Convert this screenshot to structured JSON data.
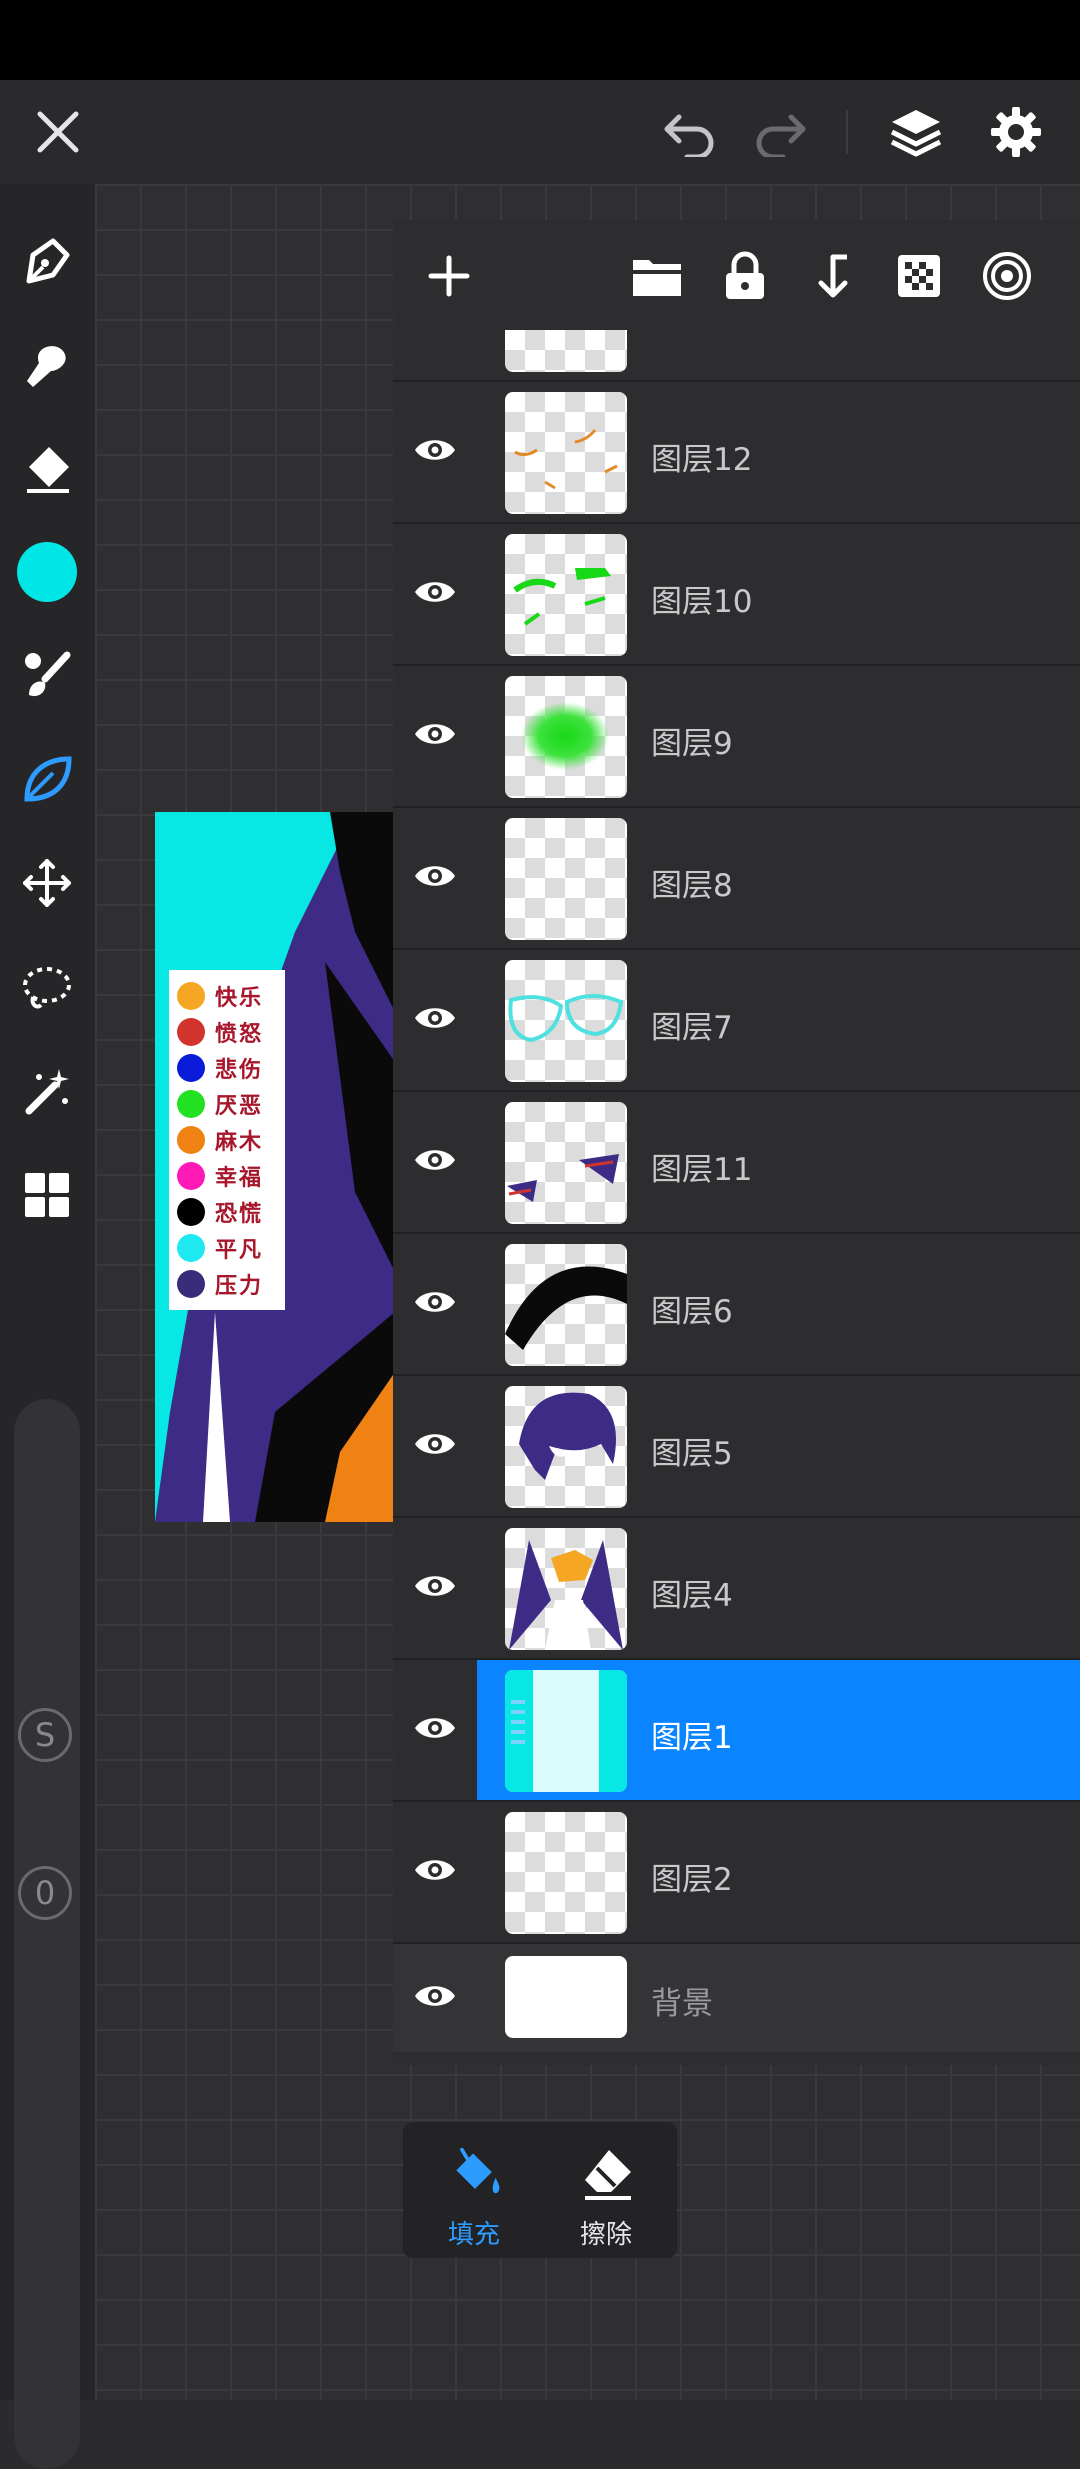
{
  "topbar": {
    "icons": [
      "close-icon",
      "undo-icon",
      "redo-icon",
      "layers-icon",
      "settings-icon"
    ]
  },
  "sidebar": {
    "icons": [
      "pen-icon",
      "smudge-icon",
      "eraser-icon",
      "color-swatch",
      "brush-icon",
      "leaf-icon",
      "move-icon",
      "lasso-icon",
      "magic-wand-icon",
      "grid-icon"
    ],
    "current_color": "#00e5e5",
    "size_label": "S",
    "opacity_label": "0"
  },
  "artwork_legend": [
    {
      "color": "#f5a623",
      "text": "快乐"
    },
    {
      "color": "#d0342c",
      "text": "愤怒"
    },
    {
      "color": "#0a1bd9",
      "text": "悲伤"
    },
    {
      "color": "#22e022",
      "text": "厌恶"
    },
    {
      "color": "#f08214",
      "text": "麻木"
    },
    {
      "color": "#ff1ab8",
      "text": "幸福"
    },
    {
      "color": "#000000",
      "text": "恐慌"
    },
    {
      "color": "#1ee8f0",
      "text": "平凡"
    },
    {
      "color": "#3a2c7a",
      "text": "压力"
    }
  ],
  "layers_panel": {
    "toolbar_icons": [
      "add-icon",
      "folder-icon",
      "lock-icon",
      "merge-down-icon",
      "transparency-icon",
      "reference-icon"
    ],
    "layers": [
      {
        "name": "图层12",
        "visible": true,
        "selected": false
      },
      {
        "name": "图层10",
        "visible": true,
        "selected": false
      },
      {
        "name": "图层9",
        "visible": true,
        "selected": false
      },
      {
        "name": "图层8",
        "visible": true,
        "selected": false
      },
      {
        "name": "图层7",
        "visible": true,
        "selected": false
      },
      {
        "name": "图层11",
        "visible": true,
        "selected": false
      },
      {
        "name": "图层6",
        "visible": true,
        "selected": false
      },
      {
        "name": "图层5",
        "visible": true,
        "selected": false
      },
      {
        "name": "图层4",
        "visible": true,
        "selected": false
      },
      {
        "name": "图层1",
        "visible": true,
        "selected": true
      },
      {
        "name": "图层2",
        "visible": true,
        "selected": false
      },
      {
        "name": "背景",
        "visible": true,
        "selected": false
      }
    ]
  },
  "bottom_tools": {
    "fill_label": "填充",
    "erase_label": "擦除",
    "active_color": "#2e9bff"
  }
}
